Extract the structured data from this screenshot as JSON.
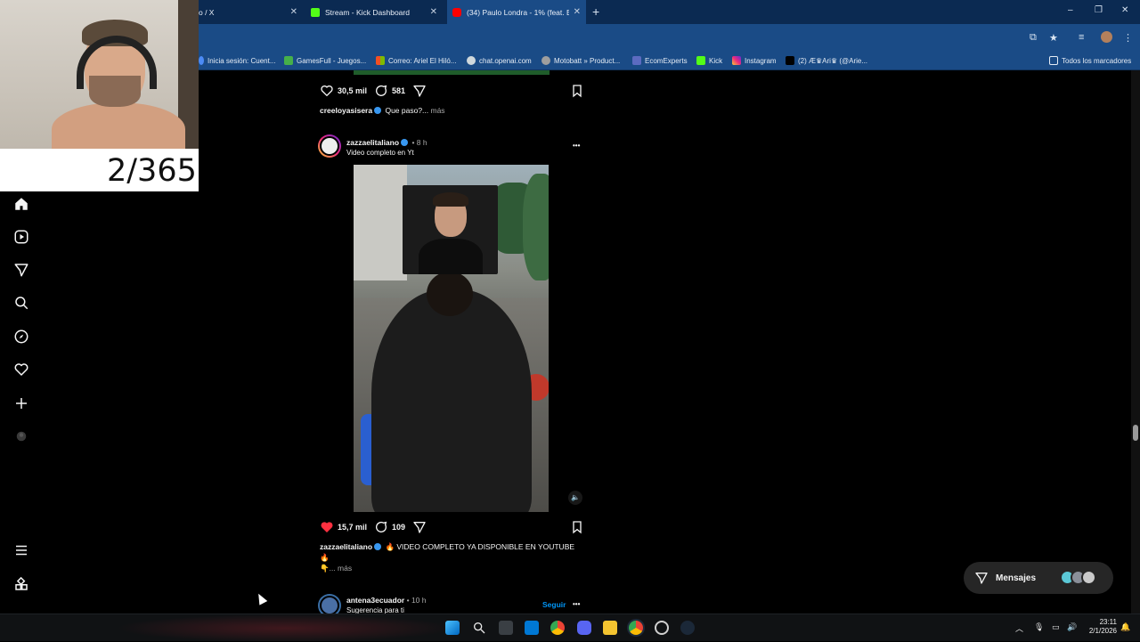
{
  "browser": {
    "tabs": [
      {
        "title": "o / X",
        "active": false
      },
      {
        "title": "Stream - Kick Dashboard",
        "active": false
      },
      {
        "title": "(34) Paulo Londra - 1% (feat. El",
        "active": true
      }
    ],
    "new_tab": "+",
    "window_controls": {
      "minimize": "–",
      "restore": "❐",
      "close": "✕"
    },
    "bookmarks": [
      {
        "label": "Inicia sesión: Cuent...",
        "color": "#4c8bf5"
      },
      {
        "label": "GamesFull - Juegos...",
        "color": "#46b04a"
      },
      {
        "label": "Correo: Ariel El Hiló...",
        "color": "#f25022"
      },
      {
        "label": "chat.openai.com",
        "color": "#cfd8dc"
      },
      {
        "label": "Motobatt » Product...",
        "color": "#9e9e9e"
      },
      {
        "label": "EcomExperts",
        "color": "#5c6bc0"
      },
      {
        "label": "Kick",
        "color": "#53fc18"
      },
      {
        "label": "Instagram",
        "color": "#e1306c"
      },
      {
        "label": "(2) Æ♛Ari♛ (@Arie...",
        "color": "#000000"
      }
    ],
    "all_bookmarks": "Todos los marcadores"
  },
  "overlay": {
    "counter": "2/365"
  },
  "sidebar": {
    "icons": [
      "home-icon",
      "reels-icon",
      "direct-icon",
      "search-icon",
      "explore-icon",
      "heart-icon",
      "create-icon",
      "profile-icon"
    ],
    "bottom": [
      "menu-icon",
      "apps-icon"
    ]
  },
  "feed": {
    "prev_post": {
      "likes": "30,5 mil",
      "comments": "581",
      "caption_user": "creeloyasisera",
      "caption_text": "Que paso?...",
      "more": "más"
    },
    "post": {
      "username": "zazzaelitaliano",
      "time": "8 h",
      "subtitle": "Video completo en Yt",
      "more_menu": "•••",
      "likes": "15,7 mil",
      "comments": "109",
      "caption_user": "zazzaelitaliano",
      "caption_text": "🔥 VIDEO COMPLETO YA DISPONIBLE EN YOUTUBE",
      "caption_line2": "🔥",
      "caption_line3": "👇... más"
    },
    "next_post": {
      "username": "antena3ecuador",
      "time": "10 h",
      "subtitle": "Sugerencia para ti",
      "follow": "Seguir",
      "more_menu": "•••"
    }
  },
  "messages": {
    "label": "Mensajes"
  },
  "taskbar": {
    "clock_time": "23:11",
    "clock_date": "2/1/2026"
  },
  "colors": {
    "accent": "#0095f6",
    "like_red": "#ff3040",
    "chrome_blue": "#1a4b86"
  }
}
